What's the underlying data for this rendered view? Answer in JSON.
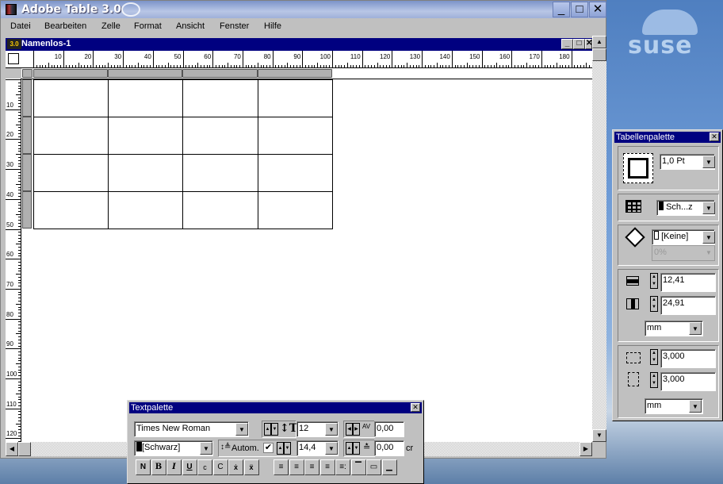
{
  "app": {
    "title": "Adobe Table 3.0",
    "icon": "adobe-table-icon",
    "min": "_",
    "max": "□",
    "close": "✕"
  },
  "menu": [
    "Datei",
    "Bearbeiten",
    "Zelle",
    "Format",
    "Ansicht",
    "Fenster",
    "Hilfe"
  ],
  "document": {
    "title": "Namenlos-1",
    "icon_label": "3.0",
    "rows": 4,
    "cols": 4
  },
  "ruler": {
    "h": [
      "10",
      "20",
      "30",
      "40",
      "50",
      "60",
      "70",
      "80",
      "90",
      "100",
      "110",
      "120",
      "130",
      "140",
      "150",
      "160",
      "170",
      "180"
    ],
    "v": [
      "10",
      "20",
      "30",
      "40",
      "50",
      "60",
      "70",
      "80",
      "90",
      "100",
      "110",
      "120"
    ]
  },
  "desktop": {
    "logo": "suse"
  },
  "tablepalette": {
    "title": "Tabellenpalette",
    "stroke": "1,0 Pt",
    "color": "Sch...z",
    "fill": "[Keine]",
    "tint": "0%",
    "row_height": "12,41",
    "col_width": "24,91",
    "unit1": "mm",
    "inset_h": "3,000",
    "inset_v": "3,000",
    "unit2": "mm"
  },
  "textpalette": {
    "title": "Textpalette",
    "font": "Times New Roman",
    "size": "12",
    "tracking": "0,00",
    "color": "[Schwarz]",
    "leading_label": "Autom.",
    "leading_auto": true,
    "leading": "14,4",
    "baseline": "0,00",
    "baseline_unit": "cr",
    "style_buttons": [
      "N",
      "B",
      "I",
      "U",
      "c",
      "C",
      "ẋ",
      "ẍ"
    ],
    "align_buttons": [
      "align-left",
      "align-right",
      "align-center",
      "justify",
      "align-decimal",
      "valign-top",
      "valign-center",
      "valign-bottom"
    ]
  }
}
